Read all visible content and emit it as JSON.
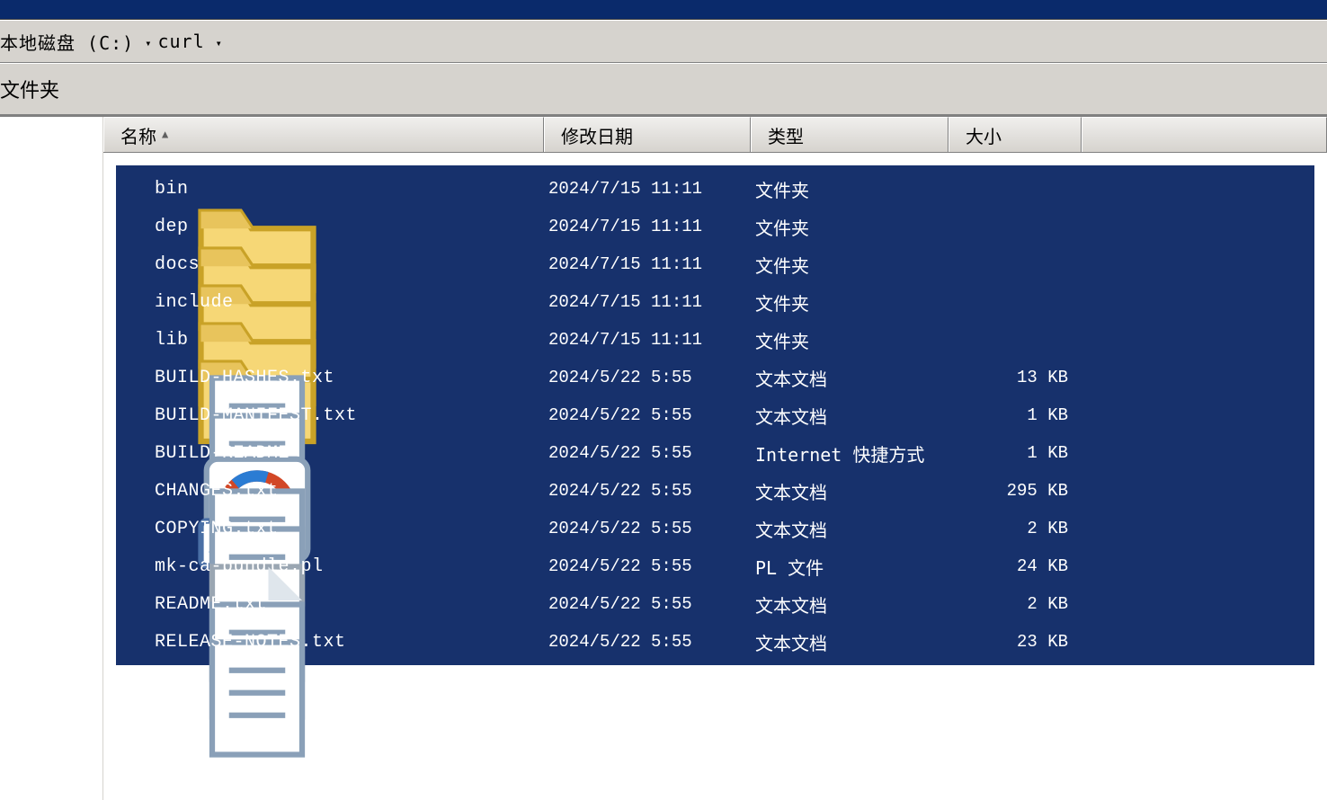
{
  "path": {
    "seg1": "本地磁盘 (C:)",
    "seg2": "curl"
  },
  "toolbar": {
    "label": "文件夹"
  },
  "columns": {
    "name": "名称",
    "date": "修改日期",
    "type": "类型",
    "size": "大小"
  },
  "items": [
    {
      "icon": "folder",
      "name": "bin",
      "date": "2024/7/15 11:11",
      "type": "文件夹",
      "size": ""
    },
    {
      "icon": "folder",
      "name": "dep",
      "date": "2024/7/15 11:11",
      "type": "文件夹",
      "size": ""
    },
    {
      "icon": "folder",
      "name": "docs",
      "date": "2024/7/15 11:11",
      "type": "文件夹",
      "size": ""
    },
    {
      "icon": "folder",
      "name": "include",
      "date": "2024/7/15 11:11",
      "type": "文件夹",
      "size": ""
    },
    {
      "icon": "folder",
      "name": "lib",
      "date": "2024/7/15 11:11",
      "type": "文件夹",
      "size": ""
    },
    {
      "icon": "text",
      "name": "BUILD-HASHES.txt",
      "date": "2024/5/22 5:55",
      "type": "文本文档",
      "size": "13 KB"
    },
    {
      "icon": "text",
      "name": "BUILD-MANIFEST.txt",
      "date": "2024/5/22 5:55",
      "type": "文本文档",
      "size": "1 KB"
    },
    {
      "icon": "url",
      "name": "BUILD-README",
      "date": "2024/5/22 5:55",
      "type": "Internet 快捷方式",
      "size": "1 KB"
    },
    {
      "icon": "text",
      "name": "CHANGES.txt",
      "date": "2024/5/22 5:55",
      "type": "文本文档",
      "size": "295 KB"
    },
    {
      "icon": "text",
      "name": "COPYING.txt",
      "date": "2024/5/22 5:55",
      "type": "文本文档",
      "size": "2 KB"
    },
    {
      "icon": "pl",
      "name": "mk-ca-bundle.pl",
      "date": "2024/5/22 5:55",
      "type": "PL 文件",
      "size": "24 KB"
    },
    {
      "icon": "text",
      "name": "README.txt",
      "date": "2024/5/22 5:55",
      "type": "文本文档",
      "size": "2 KB"
    },
    {
      "icon": "text",
      "name": "RELEASE-NOTES.txt",
      "date": "2024/5/22 5:55",
      "type": "文本文档",
      "size": "23 KB"
    }
  ]
}
